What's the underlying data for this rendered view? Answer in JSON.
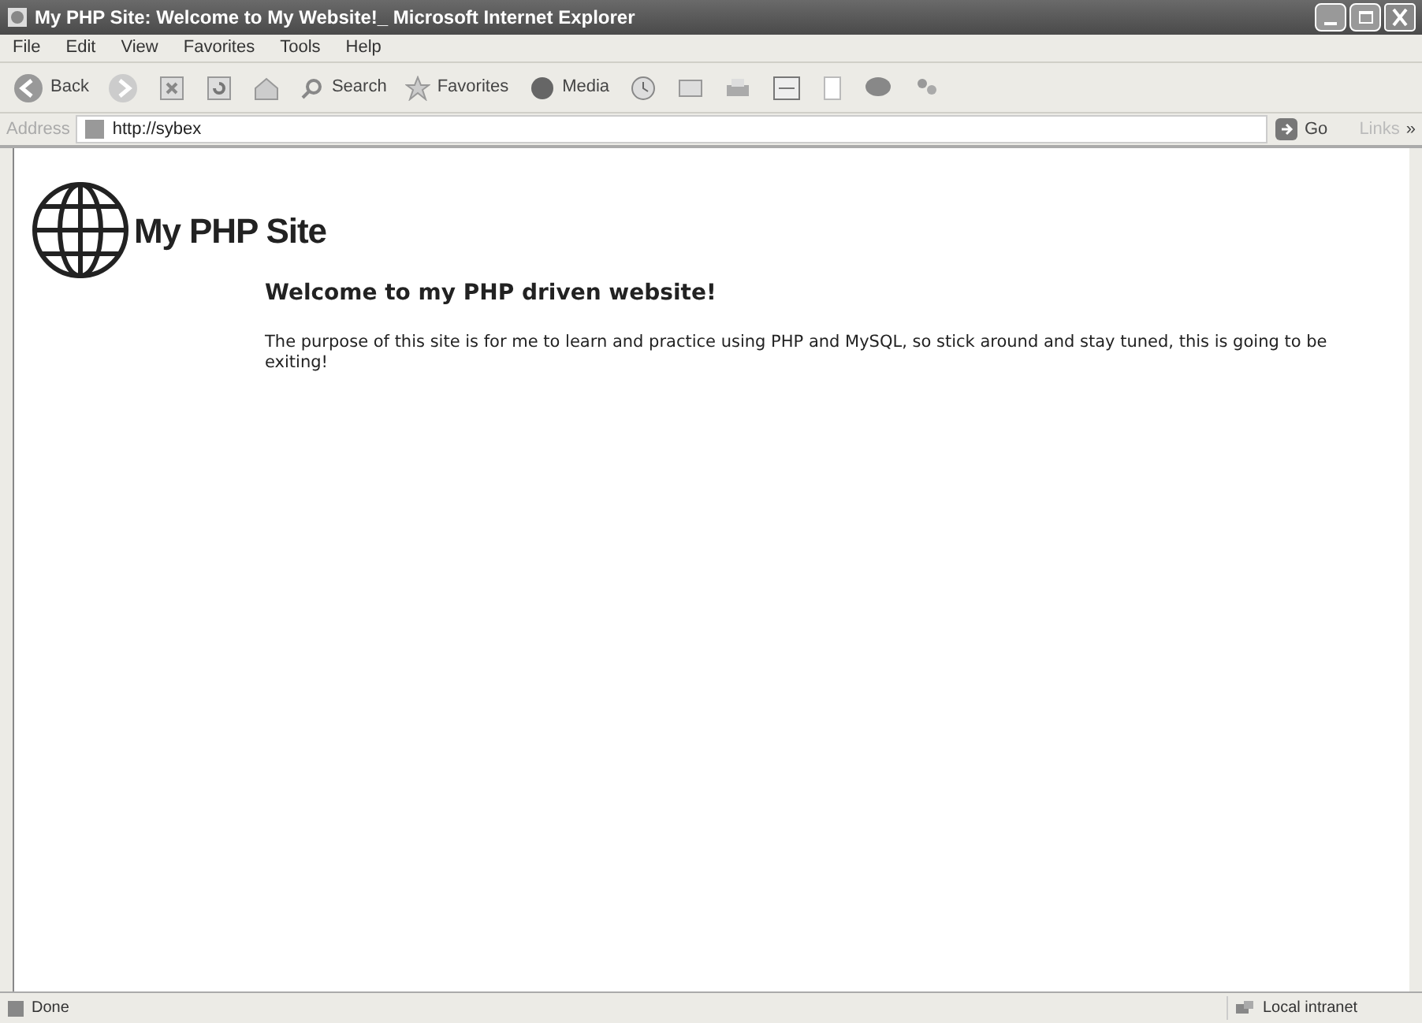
{
  "window": {
    "title": "My PHP Site: Welcome to My Website!_ Microsoft Internet Explorer"
  },
  "menu": [
    "File",
    "Edit",
    "View",
    "Favorites",
    "Tools",
    "Help"
  ],
  "toolbar": {
    "back": "Back",
    "search": "Search",
    "favorites": "Favorites",
    "media": "Media"
  },
  "address_bar": {
    "label": "Address",
    "value": "http://sybex",
    "go": "Go",
    "links": "Links",
    "more": "»"
  },
  "page": {
    "site_title": "My PHP Site",
    "heading": "Welcome to my PHP driven website!",
    "paragraph": "The purpose of this site is for me to learn and practice using PHP and MySQL, so stick around and stay tuned, this is going to be exiting!"
  },
  "status_bar": {
    "status": "Done",
    "zone": "Local intranet"
  }
}
